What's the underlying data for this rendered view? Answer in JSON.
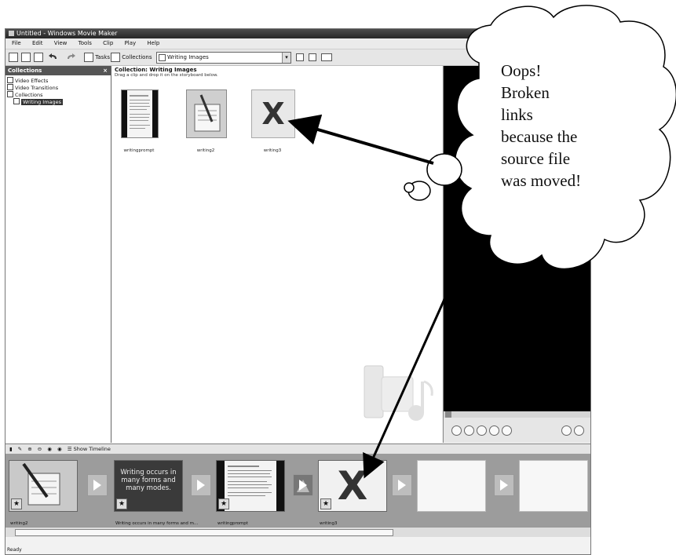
{
  "window": {
    "title": "Untitled - Windows Movie Maker",
    "menu": [
      "File",
      "Edit",
      "View",
      "Tools",
      "Clip",
      "Play",
      "Help"
    ],
    "toolbar": {
      "tasks_label": "Tasks",
      "collections_label": "Collections",
      "combo_value": "Writing Images"
    }
  },
  "collections_panel": {
    "header": "Collections",
    "close": "×",
    "items": [
      "Video Effects",
      "Video Transitions",
      "Collections",
      "Writing Images"
    ]
  },
  "content": {
    "heading": "Collection: Writing Images",
    "subheading": "Drag a clip and drop it on the storyboard below.",
    "clips": [
      {
        "name": "writingprompt",
        "icon": "document-thumbnail-icon"
      },
      {
        "name": "writing2",
        "icon": "pen-and-notebook-thumbnail-icon"
      },
      {
        "name": "writing3",
        "icon": "broken-link-x-icon",
        "glyph": "X"
      }
    ]
  },
  "storyboard": {
    "toggle_label": "Show Timeline",
    "frames": [
      {
        "label": "writing2",
        "kind": "image"
      },
      {
        "label": "Writing occurs in many forms and m...",
        "kind": "text",
        "text": "Writing occurs in many forms and many modes."
      },
      {
        "label": "writingprompt",
        "kind": "document"
      },
      {
        "label": "writing3",
        "kind": "broken",
        "glyph": "X"
      },
      {
        "label": "",
        "kind": "empty"
      },
      {
        "label": "",
        "kind": "empty"
      }
    ],
    "star": "★",
    "status": "Ready"
  },
  "callout": {
    "lines": [
      "Oops!",
      "Broken",
      "links",
      "because the",
      "source file",
      "was moved!"
    ]
  },
  "colors": {
    "titlebar": "#333333",
    "monitor": "#000000",
    "storyboard": "#9c9c9c"
  }
}
